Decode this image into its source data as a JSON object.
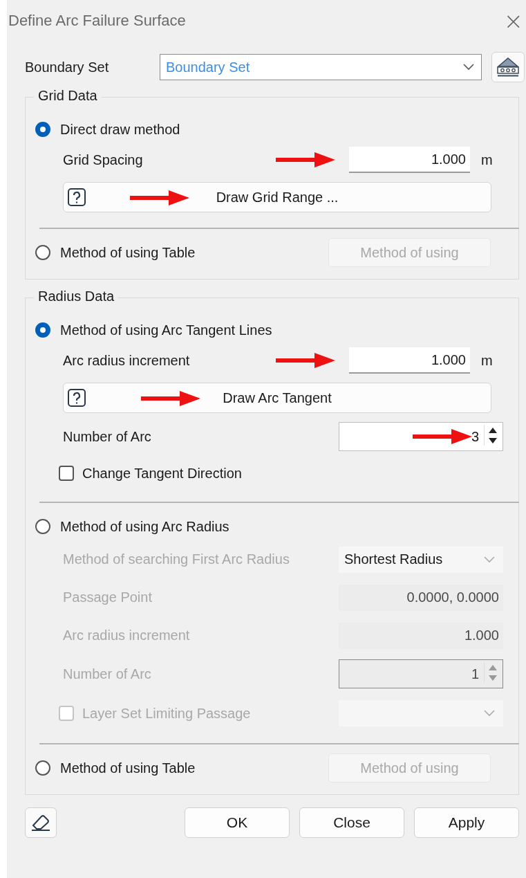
{
  "window": {
    "title": "Define Arc Failure Surface",
    "close": "×"
  },
  "boundary_set": {
    "label": "Boundary Set",
    "value": "Boundary Set"
  },
  "groups": [
    {
      "title": "Grid Data",
      "options": [
        {
          "label": "Direct draw method",
          "selected": true,
          "rows": [
            {
              "kind": "field",
              "label": "Grid Spacing",
              "value": "1.000",
              "unit": "m",
              "arrow": true,
              "disabled": false
            },
            {
              "kind": "help_button",
              "label": "Draw Grid Range ...",
              "arrow": true
            }
          ]
        },
        {
          "label": "Method of using Table",
          "selected": false,
          "button": {
            "label": "Method of using",
            "disabled": true
          }
        }
      ]
    },
    {
      "title": "Radius Data",
      "options": [
        {
          "label": "Method of using Arc Tangent Lines",
          "selected": true,
          "rows": [
            {
              "kind": "field",
              "label": "Arc radius increment",
              "value": "1.000",
              "unit": "m",
              "arrow": true,
              "disabled": false
            },
            {
              "kind": "help_button",
              "label": "Draw Arc Tangent",
              "arrow": true
            },
            {
              "kind": "spinner",
              "label": "Number of Arc",
              "value": "3",
              "arrow": true,
              "disabled": false
            },
            {
              "kind": "checkbox",
              "label": "Change Tangent Direction",
              "checked": false,
              "disabled": false
            }
          ]
        },
        {
          "label": "Method of using Arc Radius",
          "selected": false,
          "rows": [
            {
              "kind": "dropdown",
              "label": "Method of searching First Arc Radius",
              "value": "Shortest Radius",
              "disabled": true
            },
            {
              "kind": "field",
              "label": "Passage Point",
              "value": "0.0000, 0.0000",
              "arrow": false,
              "disabled": true
            },
            {
              "kind": "field",
              "label": "Arc radius increment",
              "value": "1.000",
              "arrow": false,
              "disabled": true
            },
            {
              "kind": "spinner",
              "label": "Number of Arc",
              "value": "1",
              "arrow": false,
              "disabled": true
            },
            {
              "kind": "checkbox_dropdown",
              "label": "Layer Set Limiting Passage",
              "checked": false,
              "disabled": true
            }
          ]
        },
        {
          "label": "Method of using Table",
          "selected": false,
          "button": {
            "label": "Method of using",
            "disabled": true
          }
        }
      ]
    }
  ],
  "footer": {
    "buttons": [
      "OK",
      "Close",
      "Apply"
    ]
  }
}
